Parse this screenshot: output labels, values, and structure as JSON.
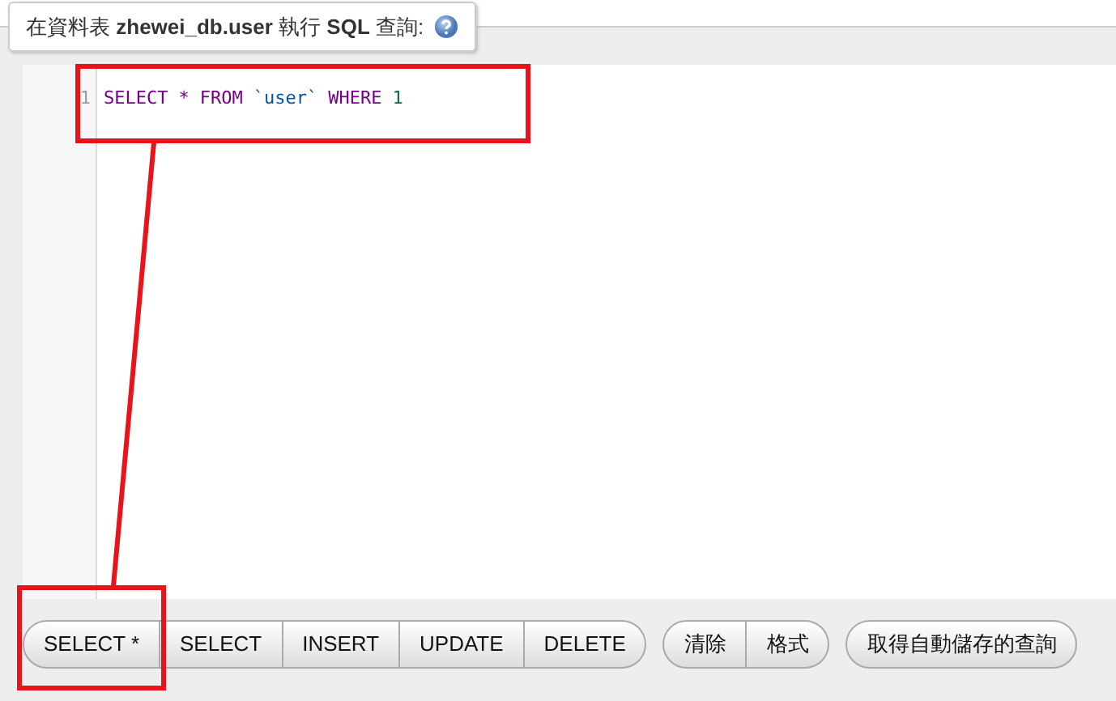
{
  "legend": {
    "text": "在資料表 **zhewei_db.user** 執行 **SQL** 查詢:"
  },
  "editor": {
    "lines": [
      {
        "number": "1",
        "tokens": [
          {
            "kind": "keyword",
            "text": "SELECT"
          },
          {
            "kind": "operator",
            "text": "*"
          },
          {
            "kind": "keyword",
            "text": "FROM"
          },
          {
            "kind": "identifier",
            "text": "`user`"
          },
          {
            "kind": "keyword",
            "text": "WHERE"
          },
          {
            "kind": "number",
            "text": "1"
          }
        ]
      }
    ]
  },
  "button_groups": [
    [
      "SELECT *",
      "SELECT",
      "INSERT",
      "UPDATE",
      "DELETE"
    ],
    [
      "清除",
      "格式"
    ],
    [
      "取得自動儲存的查詢"
    ]
  ]
}
